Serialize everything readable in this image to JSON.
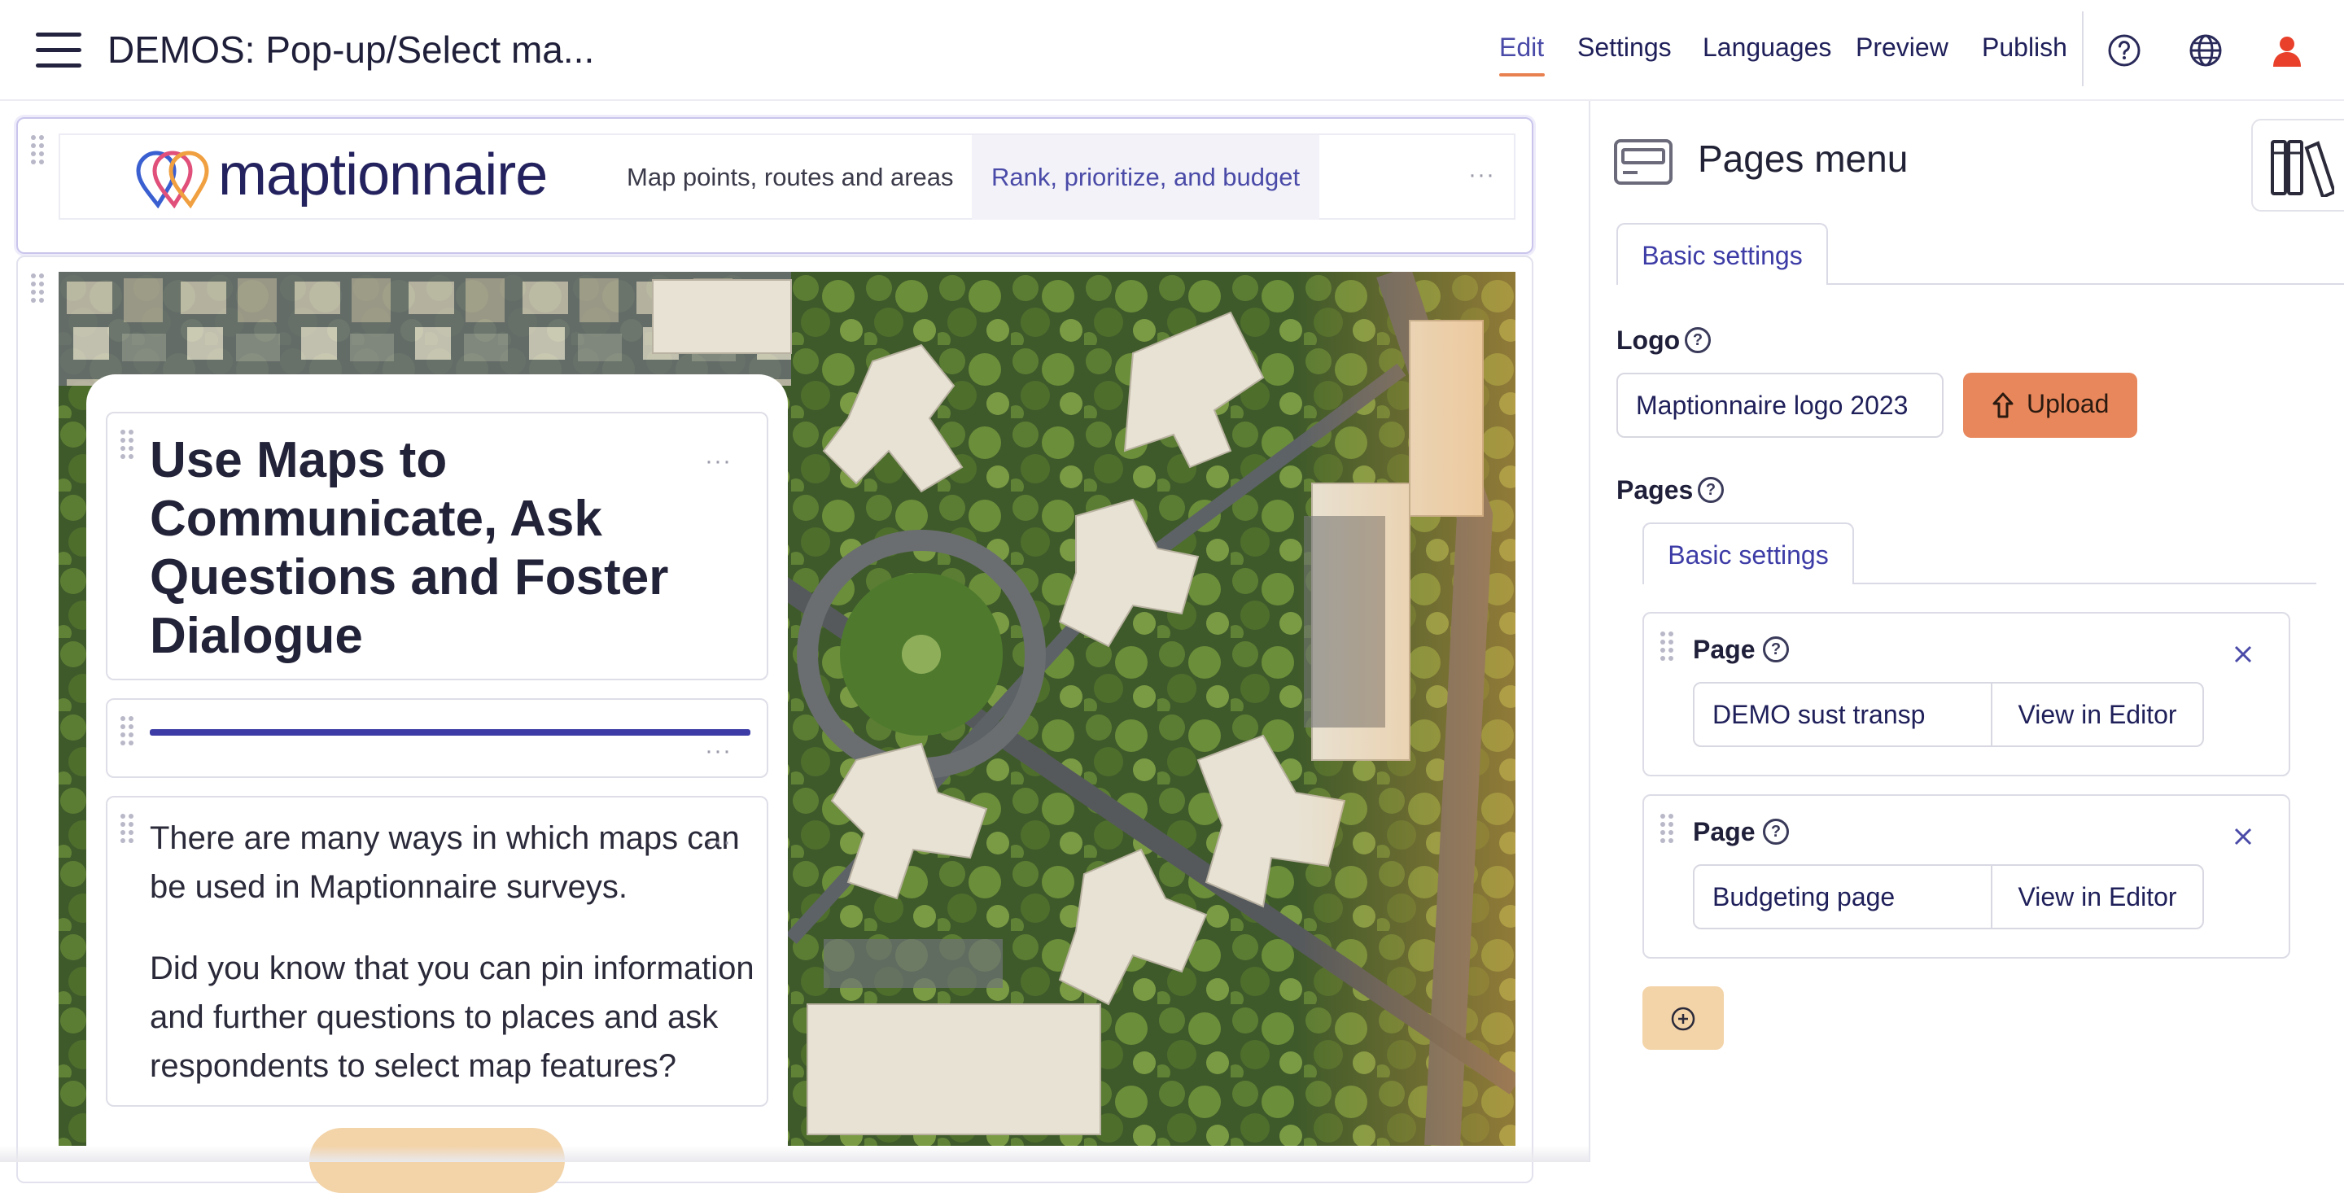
{
  "app": {
    "title": "DEMOS: Pop-up/Select ma..."
  },
  "topnav": {
    "items": [
      {
        "label": "Edit",
        "active": true
      },
      {
        "label": "Settings"
      },
      {
        "label": "Languages"
      },
      {
        "label": "Preview"
      },
      {
        "label": "Publish"
      }
    ],
    "icons": [
      "help-circle-icon",
      "globe-icon",
      "user-icon"
    ],
    "accent_color": "#e8804f",
    "user_icon_color": "#e8402a"
  },
  "survey_header": {
    "logo_text": "maptionnaire",
    "tabs": [
      {
        "label": "Map points, routes and areas"
      },
      {
        "label": "Rank, prioritize, and budget",
        "active": true
      }
    ],
    "menu_dots": "···"
  },
  "content": {
    "heading": "Use Maps to Communicate, Ask Questions and Foster Dialogue",
    "paragraph_1": "There are many ways in which maps can be used in Maptionnaire surveys.",
    "paragraph_2": "Did you know that you can pin information and further questions to places and ask respondents to select map features?",
    "dots": "···"
  },
  "panel": {
    "title": "Pages menu",
    "tab_label": "Basic settings",
    "logo": {
      "label": "Logo",
      "help": "?",
      "value": "Maptionnaire logo 2023",
      "upload_label": "Upload",
      "upload_color": "#e8875c"
    },
    "pages": {
      "label": "Pages",
      "help": "?",
      "tab_label": "Basic settings",
      "items": [
        {
          "label": "Page",
          "help": "?",
          "value": "DEMO sust transp",
          "view_label": "View in Editor"
        },
        {
          "label": "Page",
          "help": "?",
          "value": "Budgeting page",
          "view_label": "View in Editor"
        }
      ]
    }
  }
}
